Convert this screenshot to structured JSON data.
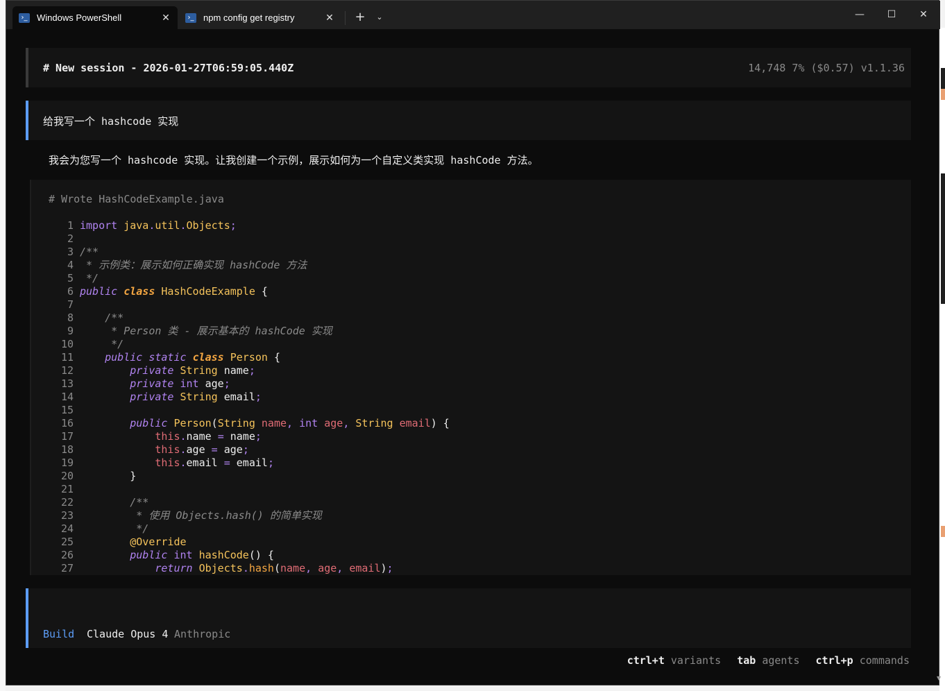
{
  "tabs": [
    {
      "label": "Windows PowerShell",
      "icon": "powershell-icon",
      "active": true
    },
    {
      "label": "npm config get registry",
      "icon": "powershell-icon",
      "active": false
    }
  ],
  "window_controls": {
    "new_tab": "+",
    "dropdown": "⌄",
    "minimize": "—",
    "maximize": "☐",
    "close": "✕",
    "tab_close": "✕"
  },
  "session": {
    "title": "# New session - 2026-01-27T06:59:05.440Z",
    "stats": "14,748  7% ($0.57) v1.1.36"
  },
  "user_message": "给我写一个 hashcode 实现",
  "assistant_message": "我会为您写一个 hashcode 实现。让我创建一个示例，展示如何为一个自定义类实现 hashCode 方法。",
  "tool": {
    "title": "# Wrote HashCodeExample.java",
    "code_lines": [
      "import java.util.Objects;",
      "",
      "/**",
      " * 示例类：展示如何正确实现 hashCode 方法",
      " */",
      "public class HashCodeExample {",
      "",
      "    /**",
      "     * Person 类 - 展示基本的 hashCode 实现",
      "     */",
      "    public static class Person {",
      "        private String name;",
      "        private int age;",
      "        private String email;",
      "",
      "        public Person(String name, int age, String email) {",
      "            this.name = name;",
      "            this.age = age;",
      "            this.email = email;",
      "        }",
      "",
      "        /**",
      "         * 使用 Objects.hash() 的简单实现",
      "         */",
      "        @Override",
      "        public int hashCode() {",
      "            return Objects.hash(name, age, email);"
    ]
  },
  "input": {
    "mode": "Build",
    "model": "Claude Opus 4",
    "provider": "Anthropic"
  },
  "shortcuts": [
    {
      "key": "ctrl+t",
      "desc": "variants"
    },
    {
      "key": "tab",
      "desc": "agents"
    },
    {
      "key": "ctrl+p",
      "desc": "commands"
    }
  ],
  "colors": {
    "accent": "#5c9cf5",
    "background": "#0c0c0c",
    "panel": "#141414",
    "keyword": "#b083f0",
    "type": "#f5c35b",
    "param": "#e06c75",
    "comment": "#8a8a8a"
  }
}
